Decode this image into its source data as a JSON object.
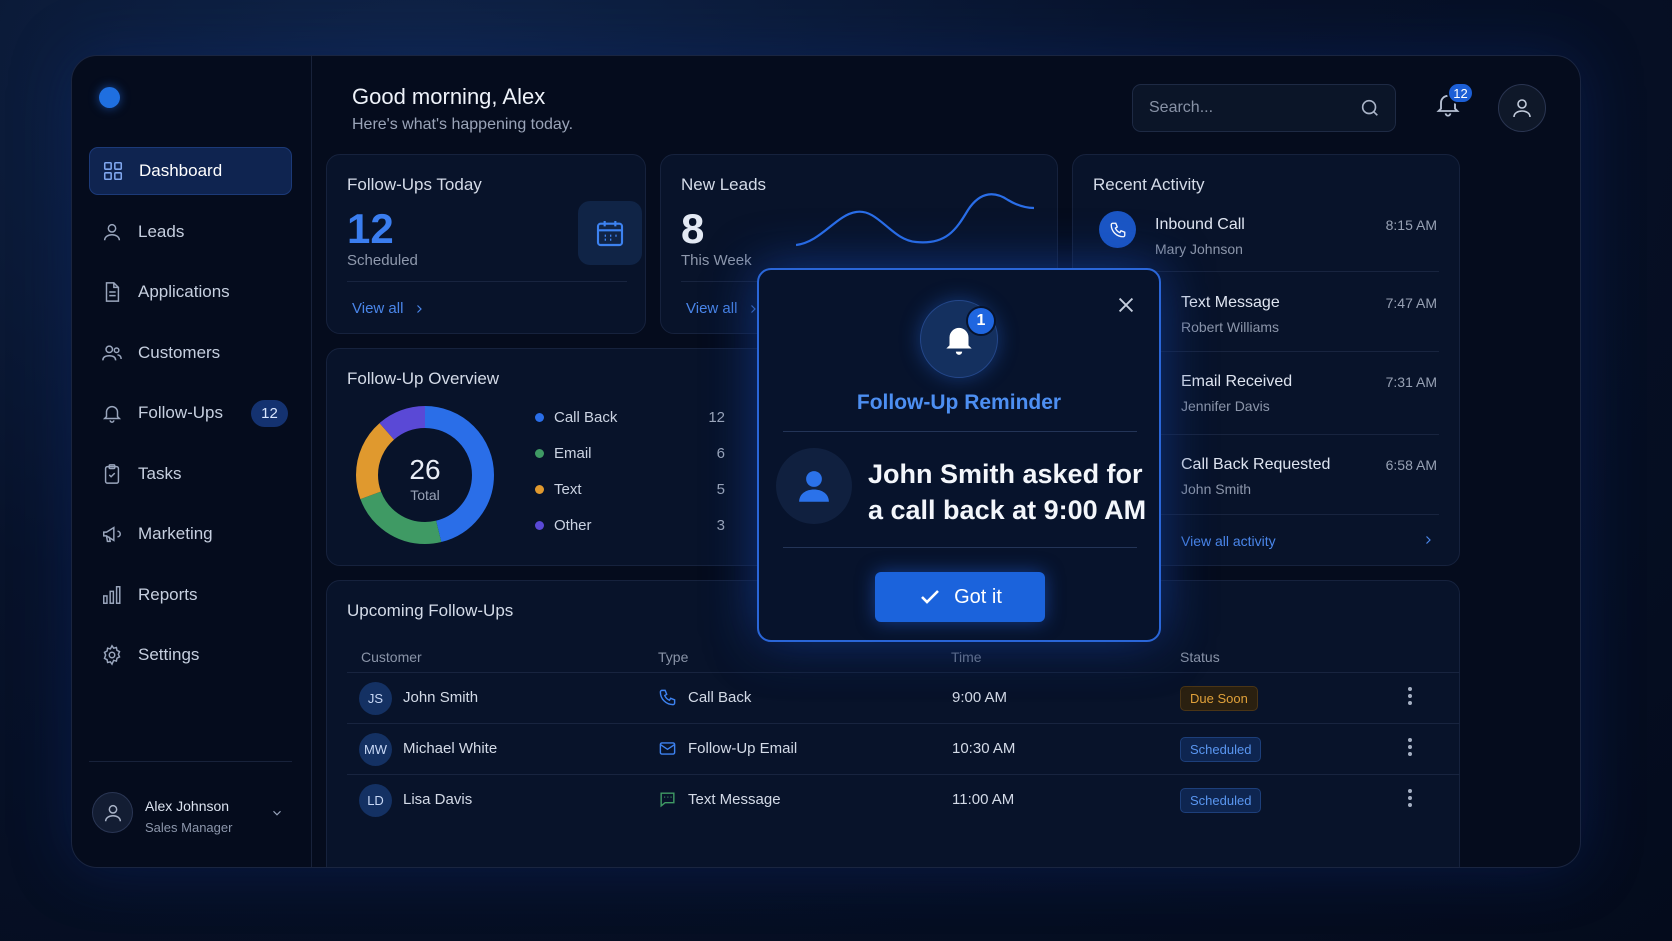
{
  "header": {
    "greeting": "Good morning, Alex",
    "subtitle": "Here's what's happening today.",
    "search_placeholder": "Search...",
    "notification_count": "12"
  },
  "sidebar": {
    "items": [
      {
        "label": "Dashboard",
        "icon": "grid-icon"
      },
      {
        "label": "Leads",
        "icon": "user-icon"
      },
      {
        "label": "Applications",
        "icon": "document-icon"
      },
      {
        "label": "Customers",
        "icon": "users-icon"
      },
      {
        "label": "Follow-Ups",
        "icon": "bell-icon",
        "badge": "12"
      },
      {
        "label": "Tasks",
        "icon": "clipboard-check-icon"
      },
      {
        "label": "Marketing",
        "icon": "megaphone-icon"
      },
      {
        "label": "Reports",
        "icon": "bar-chart-icon"
      },
      {
        "label": "Settings",
        "icon": "gear-icon"
      }
    ],
    "user": {
      "name": "Alex Johnson",
      "role": "Sales Manager"
    }
  },
  "followups_today": {
    "title": "Follow-Ups Today",
    "value": "12",
    "label": "Scheduled",
    "view_all": "View all"
  },
  "new_leads": {
    "title": "New Leads",
    "value": "8",
    "label": "This Week",
    "view_all": "View all"
  },
  "overview": {
    "title": "Follow-Up Overview",
    "total": "26",
    "total_label": "Total",
    "legend": [
      {
        "label": "Call Back",
        "value": "12",
        "color": "#2a6ee8"
      },
      {
        "label": "Email",
        "value": "6",
        "color": "#3f9a64"
      },
      {
        "label": "Text",
        "value": "5",
        "color": "#e0992e"
      },
      {
        "label": "Other",
        "value": "3",
        "color": "#5a49d6"
      }
    ]
  },
  "activity": {
    "title": "Recent Activity",
    "items": [
      {
        "title": "Inbound Call",
        "name": "Mary Johnson",
        "time": "8:15 AM"
      },
      {
        "title": "Text Message",
        "name": "Robert Williams",
        "time": "7:47 AM"
      },
      {
        "title": "Email Received",
        "name": "Jennifer Davis",
        "time": "7:31 AM"
      },
      {
        "title": "Call Back Requested",
        "name": "John Smith",
        "time": "6:58 AM"
      }
    ],
    "view_all": "View all activity"
  },
  "upcoming": {
    "title": "Upcoming Follow-Ups",
    "columns": [
      "Customer",
      "Type",
      "Time",
      "Status"
    ],
    "rows": [
      {
        "initials": "JS",
        "customer": "John Smith",
        "type": "Call Back",
        "time": "9:00 AM",
        "status": "Due Soon"
      },
      {
        "initials": "MW",
        "customer": "Michael White",
        "type": "Follow-Up Email",
        "time": "10:30 AM",
        "status": "Scheduled"
      },
      {
        "initials": "LD",
        "customer": "Lisa Davis",
        "type": "Text Message",
        "time": "11:00 AM",
        "status": "Scheduled"
      }
    ]
  },
  "modal": {
    "badge": "1",
    "title": "Follow-Up Reminder",
    "message": "John Smith asked for a call back at 9:00 AM",
    "button": "Got it"
  }
}
